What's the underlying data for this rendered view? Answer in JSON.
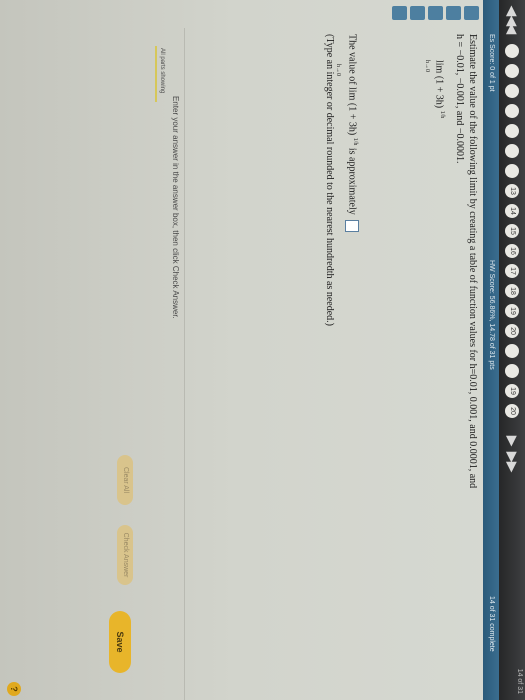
{
  "nav": {
    "first": "◀◀",
    "prev": "◀",
    "next": "▶",
    "last": "▶▶",
    "questions": [
      "",
      "",
      "",
      "",
      "",
      "",
      "",
      "13",
      "14",
      "15",
      "16",
      "17",
      "18",
      "19",
      "20",
      "",
      "",
      "19",
      "20"
    ],
    "page_count": "14 of 31"
  },
  "status": {
    "score": "Es Score: 0 of 1 pt",
    "hw_score": "HW Score: 56.86%, 14.78 of 31 pts",
    "progress": "14 of 31 complete"
  },
  "question": {
    "prompt_line1": "Estimate the value of the following limit by creating a table of function values for h=0.01, 0.001, and 0.0001, and",
    "prompt_line2": "h = −0.01, −0.001, and −0.0001.",
    "limit_expression": "lim (1 + 3h)",
    "limit_sub": "h→0",
    "limit_sup": "1/h",
    "answer_prefix": "The value of  lim (1 + 3h)",
    "answer_sub": "h→0",
    "answer_sup": "1/h",
    "answer_suffix": " is approximately",
    "answer_value": "",
    "answer_hint": "(Type an integer or decimal rounded to the nearest hundredth as needed.)"
  },
  "footer": {
    "instruction": "Enter your answer in the answer box, then click Check Answer.",
    "parts_label": "All parts showing",
    "clear_all": "Clear All",
    "check_answer": "Check Answer",
    "save": "Save",
    "help": "?"
  },
  "colors": {
    "nav_bg": "#2d2e30",
    "status_bg": "#2f6283",
    "button_muted": "#d9c48c",
    "save_accent": "#e8b52a",
    "answer_border": "#5a7fa0"
  }
}
